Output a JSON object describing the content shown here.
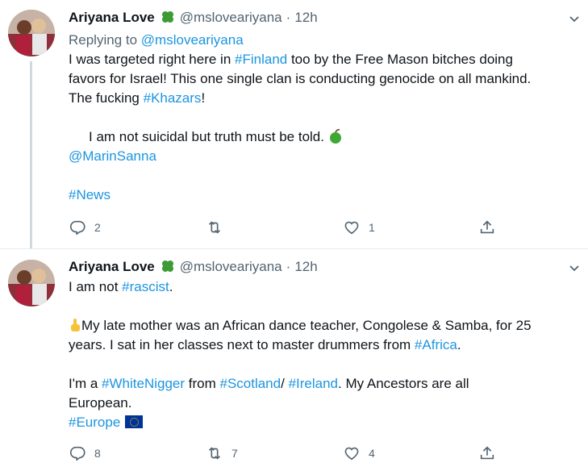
{
  "tweets": [
    {
      "name": "Ariyana Love",
      "handle": "@msloveariyana",
      "time": "12h",
      "replying_prefix": "Replying to",
      "replying_handle": "@msloveariyana",
      "l1a": "I was targeted right here in ",
      "l1b": "#Finland",
      "l1c": " too by the Free Mason bitches doing",
      "l2": "favors for Israel! This one single clan is conducting genocide on all mankind.",
      "l3a": "The fucking ",
      "l3b": "#Khazars",
      "l3c": "!",
      "l4": "I am not suicidal but truth must be told.",
      "mention": "@MarinSanna",
      "hashtag": "#News",
      "replies": "2",
      "retweets": "",
      "likes": "1"
    },
    {
      "name": "Ariyana Love",
      "handle": "@msloveariyana",
      "time": "12h",
      "l1a": "I am not ",
      "l1b": "#rascist",
      "l1c": ".",
      "l2": "My late mother was an African dance teacher, Congolese & Samba, for 25",
      "l3a": "years. I sat in her classes next to master drummers from ",
      "l3b": "#Africa",
      "l3c": ".",
      "l4a": "I'm a ",
      "l4b": "#WhiteNigger",
      "l4c": " from ",
      "l4d": "#Scotland",
      "l4e": "/ ",
      "l4f": "#Ireland",
      "l4g": ". My Ancestors are all",
      "l5": "European.",
      "hashtag": "#Europe",
      "replies": "8",
      "retweets": "7",
      "likes": "4"
    }
  ],
  "icons": {
    "clover": "four-leaf-clover",
    "apple": "green-apple",
    "hand": "index-pointing-up",
    "flag": "eu-flag"
  },
  "colors": {
    "link": "#1b95e0",
    "muted": "#536471",
    "text": "#0f1419"
  }
}
